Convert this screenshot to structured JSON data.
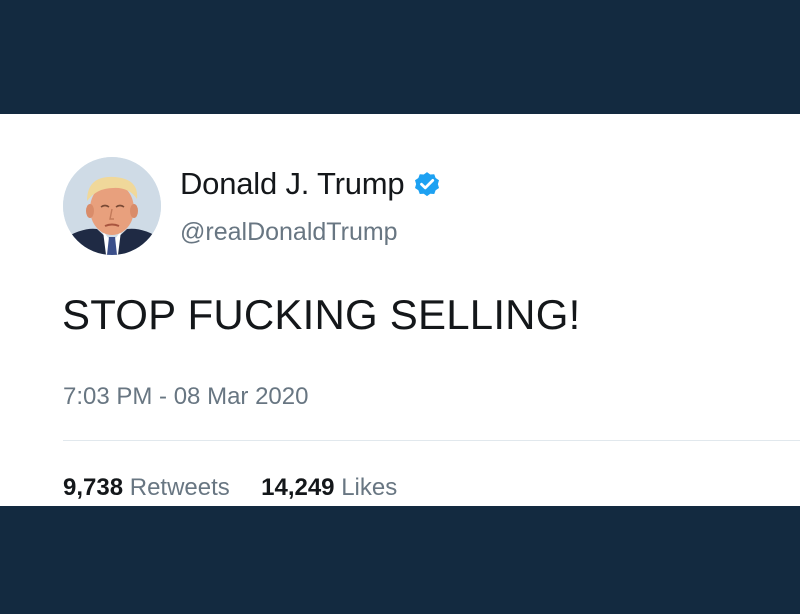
{
  "tweet": {
    "author": {
      "display_name": "Donald J. Trump",
      "handle": "@realDonaldTrump",
      "verified": true,
      "avatar_icon": "profile-photo"
    },
    "text": "STOP FUCKING SELLING!",
    "timestamp": "7:03 PM - 08 Mar 2020",
    "stats": {
      "retweets_count": "9,738",
      "retweets_label": "Retweets",
      "likes_count": "14,249",
      "likes_label": "Likes"
    }
  },
  "colors": {
    "background_band": "#132a40",
    "card": "#ffffff",
    "verified_badge": "#1da1f2",
    "primary_text": "#14171a",
    "secondary_text": "#687682"
  }
}
